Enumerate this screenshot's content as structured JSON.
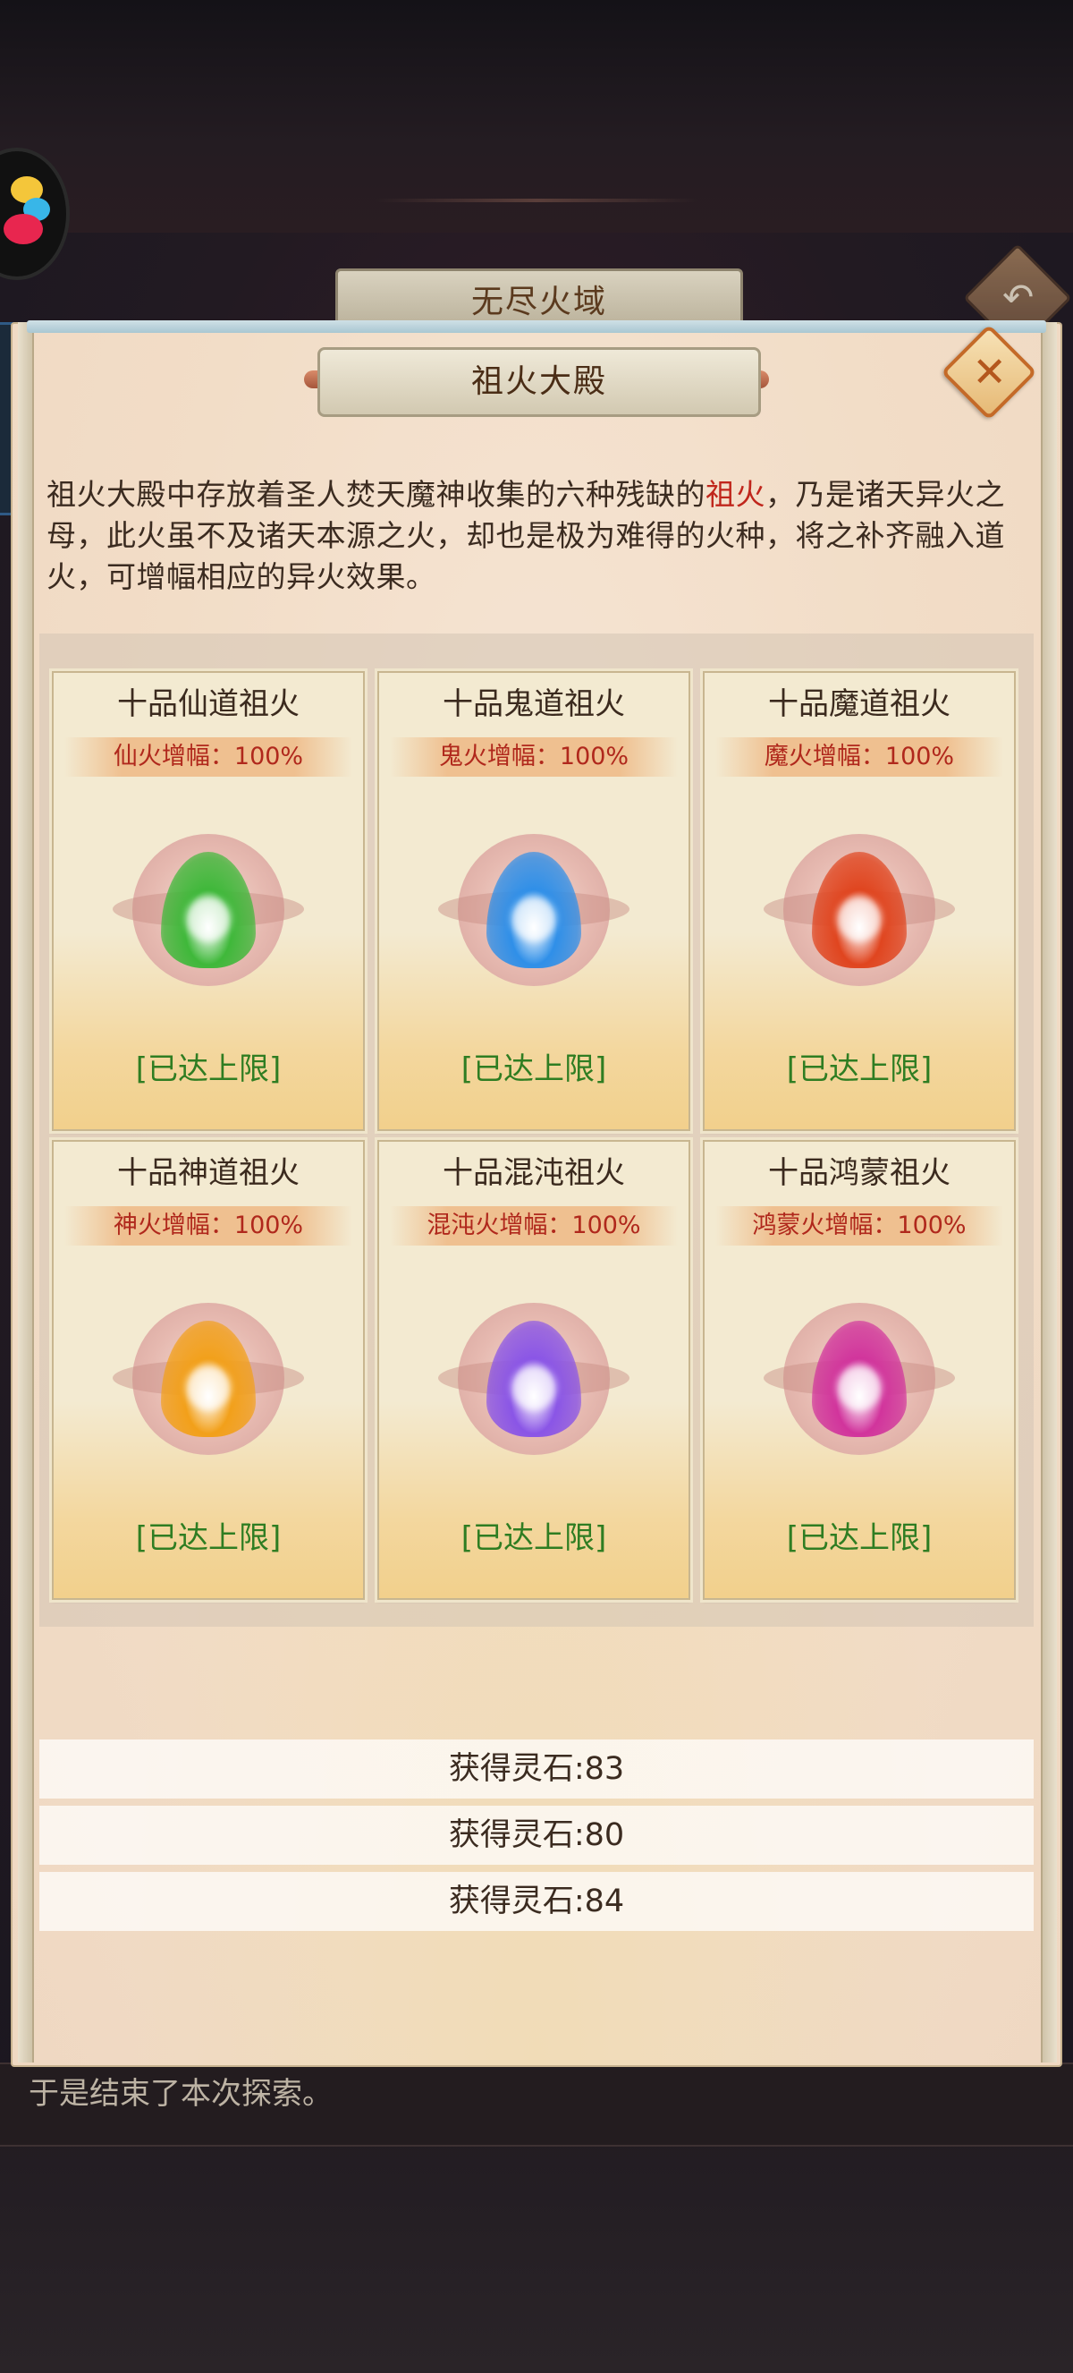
{
  "outer_window": {
    "title": "无尽火域",
    "back_icon": "back-arrow-icon"
  },
  "inner_window": {
    "title": "祖火大殿",
    "close_icon": "close-icon",
    "description": {
      "part1": "祖火大殿中存放着圣人焚天魔神收集的六种残缺的",
      "highlight": "祖火",
      "part2": "，乃是诸天异火之母，此火虽不及诸天本源之火，却也是极为难得的火种，将之补齐融入道火，可增幅相应的异火效果。"
    },
    "highlight_color": "#c0261c"
  },
  "fires": [
    {
      "name": "十品仙道祖火",
      "boost": "仙火增幅：100%",
      "status": "[已达上限]",
      "color": "#3fb83a"
    },
    {
      "name": "十品鬼道祖火",
      "boost": "鬼火增幅：100%",
      "status": "[已达上限]",
      "color": "#2f8fe8"
    },
    {
      "name": "十品魔道祖火",
      "boost": "魔火增幅：100%",
      "status": "[已达上限]",
      "color": "#e0451f"
    },
    {
      "name": "十品神道祖火",
      "boost": "神火增幅：100%",
      "status": "[已达上限]",
      "color": "#f2a01a"
    },
    {
      "name": "十品混沌祖火",
      "boost": "混沌火增幅：100%",
      "status": "[已达上限]",
      "color": "#8a55e6"
    },
    {
      "name": "十品鸿蒙祖火",
      "boost": "鸿蒙火增幅：100%",
      "status": "[已达上限]",
      "color": "#d1349c"
    }
  ],
  "rewards": [
    {
      "text": "获得灵石:83"
    },
    {
      "text": "获得灵石:80"
    },
    {
      "text": "获得灵石:84"
    }
  ],
  "log_text": "于是结束了本次探索。"
}
